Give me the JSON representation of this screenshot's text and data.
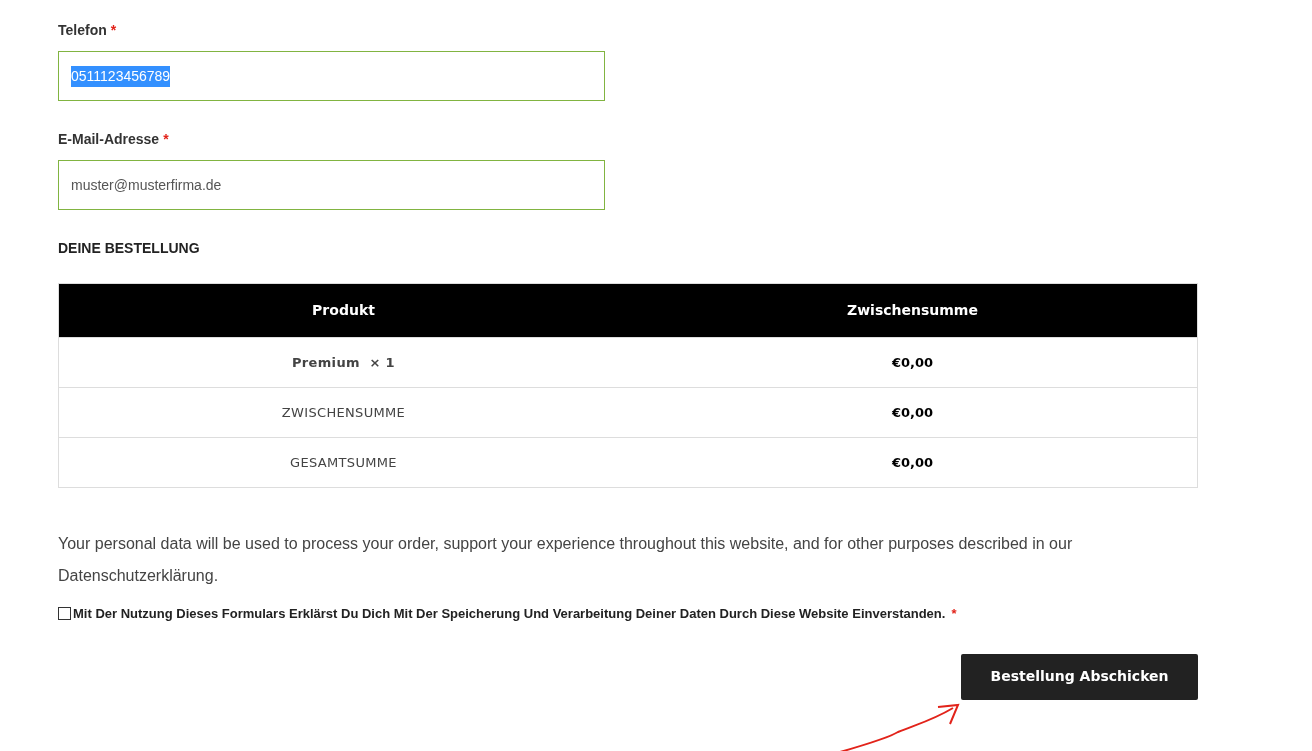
{
  "fields": [
    {
      "label": "Telefon",
      "required_mark": "*",
      "value": "0511123456789",
      "value_selected": true
    },
    {
      "label": "E-Mail-Adresse",
      "required_mark": "*",
      "value": "muster@musterfirma.de",
      "value_selected": false
    }
  ],
  "order": {
    "heading": "DEINE BESTELLUNG",
    "table": {
      "columns": [
        "Produkt",
        "Zwischensumme"
      ],
      "rows": [
        {
          "kind": "item",
          "cells": [
            "Premium  × 1",
            "€0,00"
          ]
        },
        {
          "kind": "total",
          "cells": [
            "ZWISCHENSUMME",
            "€0,00"
          ]
        },
        {
          "kind": "total",
          "cells": [
            "GESAMTSUMME",
            "€0,00"
          ]
        }
      ]
    }
  },
  "privacy_text": "Your personal data will be used to process your order, support your experience throughout this website, and for other purposes described in our Datenschutzerklärung.",
  "consent": {
    "checked": false,
    "label": "Mit Der Nutzung Dieses Formulars Erklärst Du Dich Mit Der Speicherung Und Verarbeitung Deiner Daten Durch Diese Website Einverstanden.",
    "required_mark": "*"
  },
  "submit_button": "Bestellung Abschicken"
}
